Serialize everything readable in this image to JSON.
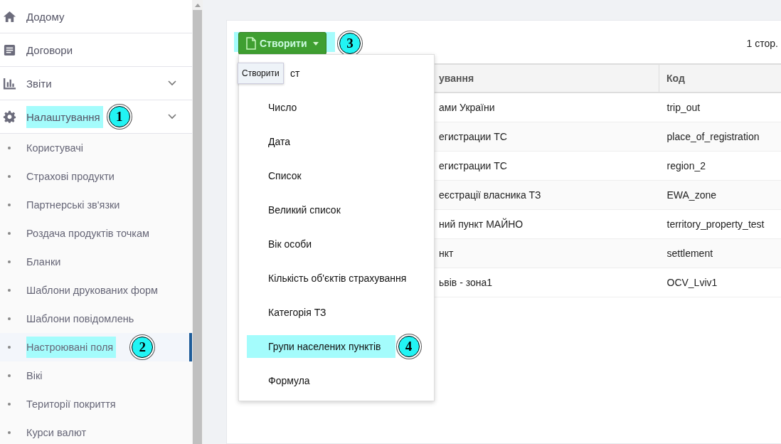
{
  "sidebar": {
    "items": [
      {
        "label": "Додому",
        "expandable": false
      },
      {
        "label": "Договори",
        "expandable": false
      },
      {
        "label": "Звіти",
        "expandable": true
      },
      {
        "label": "Налаштування",
        "expandable": true,
        "marker": "1",
        "children": [
          {
            "label": "Користувачі",
            "selected": false
          },
          {
            "label": "Страхові продукти",
            "selected": false
          },
          {
            "label": "Партнерські зв'язки",
            "selected": false
          },
          {
            "label": "Роздача продуктів точкам",
            "selected": false
          },
          {
            "label": "Бланки",
            "selected": false
          },
          {
            "label": "Шаблони друкованих форм",
            "selected": false
          },
          {
            "label": "Шаблони повідомлень",
            "selected": false
          },
          {
            "label": "Настроювані поля",
            "selected": true,
            "marker": "2"
          },
          {
            "label": "Вікі",
            "selected": false
          },
          {
            "label": "Території покриття",
            "selected": false
          },
          {
            "label": "Курси валют",
            "selected": false
          }
        ]
      }
    ]
  },
  "toolbar": {
    "create_button": {
      "label": "Створити",
      "marker": "3"
    },
    "tooltip": "Створити",
    "pagination": "1 стор."
  },
  "dropdown": {
    "items": [
      {
        "label": "ст"
      },
      {
        "label": "Число"
      },
      {
        "label": "Дата"
      },
      {
        "label": "Список"
      },
      {
        "label": "Великий список"
      },
      {
        "label": "Вік особи"
      },
      {
        "label": "Кількість об'єктів страхування"
      },
      {
        "label": "Категорія ТЗ"
      },
      {
        "label": "Групи населених пунктів",
        "marker": "4"
      },
      {
        "label": "Формула"
      }
    ]
  },
  "table": {
    "columns": [
      "ування",
      "Код"
    ],
    "rows": [
      [
        "ами України",
        "trip_out"
      ],
      [
        "егистрации ТС",
        "place_of_registration"
      ],
      [
        "егистрации ТС",
        "region_2"
      ],
      [
        "еєстрації власника ТЗ",
        "EWA_zone"
      ],
      [
        "ний пункт МАЙНО",
        "territory_property_test"
      ],
      [
        "нкт",
        "settlement"
      ],
      [
        "ьвів - зона1",
        "OCV_Lviv1"
      ]
    ]
  }
}
